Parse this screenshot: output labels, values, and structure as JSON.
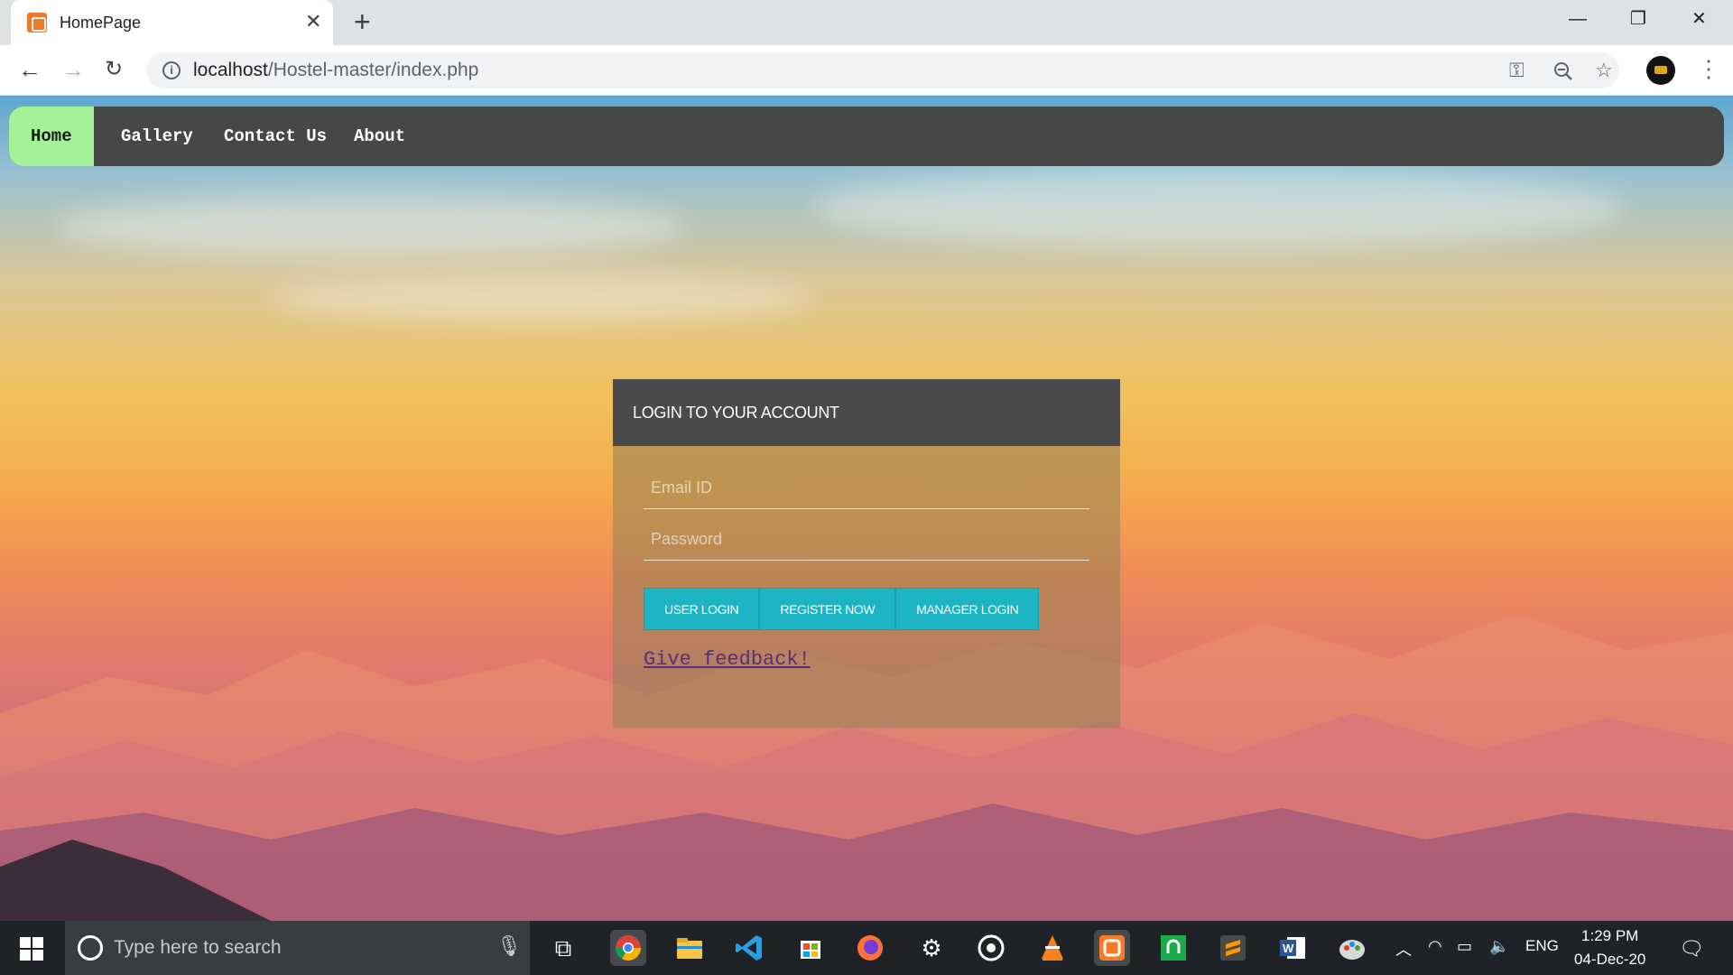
{
  "browser": {
    "tab_title": "HomePage",
    "tab_close": "✕",
    "new_tab": "+",
    "url_host": "localhost",
    "url_path": "/Hostel-master/index.php",
    "info_glyph": "i",
    "icons": [
      "key-icon",
      "zoom-out-icon",
      "star-icon",
      "profile-avatar",
      "more-menu-icon"
    ]
  },
  "navbar": {
    "items": [
      {
        "label": "Home",
        "active": true
      },
      {
        "label": "Gallery",
        "active": false
      },
      {
        "label": "Contact Us",
        "active": false
      },
      {
        "label": "About",
        "active": false
      }
    ],
    "active_color": "#a3f29a",
    "bar_color": "#474747"
  },
  "login": {
    "title": "LOGIN TO YOUR ACCOUNT",
    "email_placeholder": "Email ID",
    "password_placeholder": "Password",
    "buttons": {
      "user_login": "USER LOGIN",
      "register": "REGISTER NOW",
      "manager_login": "MANAGER LOGIN"
    },
    "button_color": "#1db5c3",
    "feedback_link": "Give feedback!"
  },
  "taskbar": {
    "search_placeholder": "Type here to search",
    "language": "ENG",
    "time": "1:29 PM",
    "date": "04-Dec-20",
    "apps": [
      "task-view",
      "chrome",
      "file-explorer",
      "vs-code",
      "microsoft-store",
      "firefox",
      "settings",
      "groove-music",
      "vlc",
      "xampp",
      "app-green",
      "sublime-text",
      "word",
      "paint-3d"
    ]
  }
}
